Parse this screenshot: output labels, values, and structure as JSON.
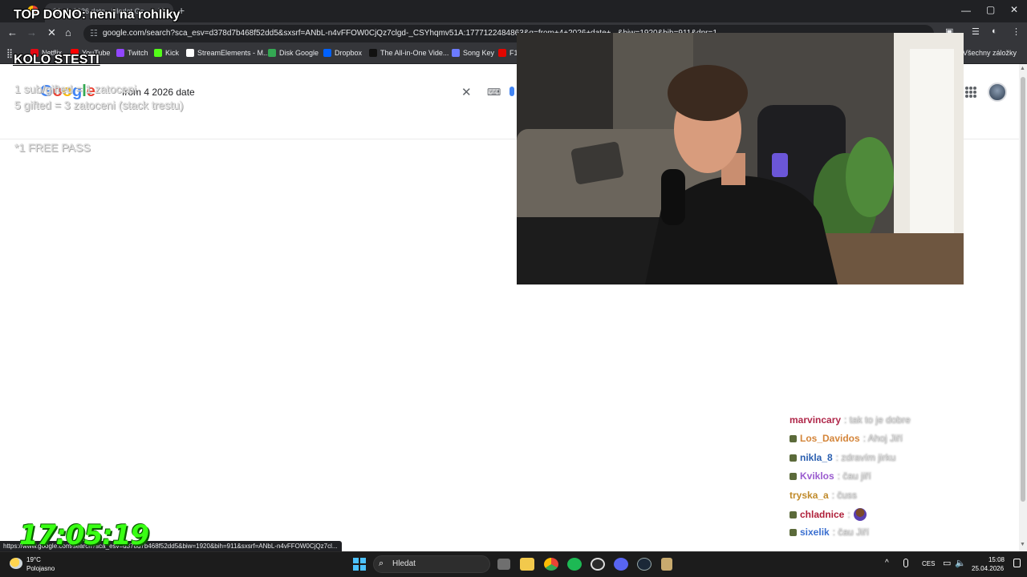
{
  "browser": {
    "tab_title": "20. 4. 2026 date - Hledat Go...",
    "url": "google.com/search?sca_esv=d378d7b468f52dd5&sxsrf=ANbL-n4vFFOW0CjQz7clgd-_CSYhqmv51A:1777122484863&q=from+4+2026+date+...&biw=1920&bih=911&dpr=1",
    "window_controls": {
      "minimize": "—",
      "maximize": "▢",
      "close": "✕"
    }
  },
  "bookmarks": [
    {
      "label": "Netflix",
      "color": "#e50914"
    },
    {
      "label": "YouTube",
      "color": "#ff0000"
    },
    {
      "label": "Twitch",
      "color": "#9146ff"
    },
    {
      "label": "Kick",
      "color": "#53fc18"
    },
    {
      "label": "StreamElements - M...",
      "color": "#ffffff"
    },
    {
      "label": "Disk Google",
      "color": "#34a853"
    },
    {
      "label": "Dropbox",
      "color": "#0061ff"
    },
    {
      "label": "The All-in-One Vide...",
      "color": "#111111"
    },
    {
      "label": "Song Key",
      "color": "#6c7bff"
    },
    {
      "label": "F1",
      "color": "#e10600"
    }
  ],
  "bookmarks_all": "Všechny záložky",
  "google": {
    "logo_letters": [
      "G",
      "o",
      "o",
      "g",
      "l",
      "e"
    ],
    "query": "from 4 2026 date"
  },
  "overlays": {
    "top_dono": "TOP DONO: neni na rohliky",
    "kolo_title": "KOLO STESTI",
    "rule_1": "1 sub/gifted = 1 zatoceni",
    "rule_2": "5 gifted = 3 zatoceni (stack trestu)",
    "free_pass": "*1 FREE PASS",
    "clock": "17:05:19"
  },
  "chat": [
    {
      "user": "marvincary",
      "color": "#b0284a",
      "msg": ": tak to je dobre",
      "badge": false
    },
    {
      "user": "Los_Davidos",
      "color": "#d4853a",
      "msg": ": Ahoj Jiří",
      "badge": true
    },
    {
      "user": "nikla_8",
      "color": "#2a5fb0",
      "msg": ": zdravím jirku",
      "badge": true
    },
    {
      "user": "Kviklos",
      "color": "#9a5ccf",
      "msg": ": čau jiří",
      "badge": true
    },
    {
      "user": "tryska_a",
      "color": "#c08a2a",
      "msg": ": čuss",
      "badge": false
    },
    {
      "user": "chladnice",
      "color": "#b0203a",
      "msg": ":",
      "badge": true,
      "emote": true
    },
    {
      "user": "sixelik",
      "color": "#3a6fd0",
      "msg": ": čau Jiří",
      "badge": true
    }
  ],
  "status_url": "https://www.google.com/search?sca_esv=d378d7b468f52dd5&biw=1920&bih=911&sxsrf=ANbL-n4vFFOW0CjQz7cl...",
  "taskbar": {
    "weather_temp": "19°C",
    "weather_desc": "Polojasno",
    "search_placeholder": "Hledat",
    "lang": "CES",
    "time": "15:08",
    "date": "25.04.2026"
  }
}
